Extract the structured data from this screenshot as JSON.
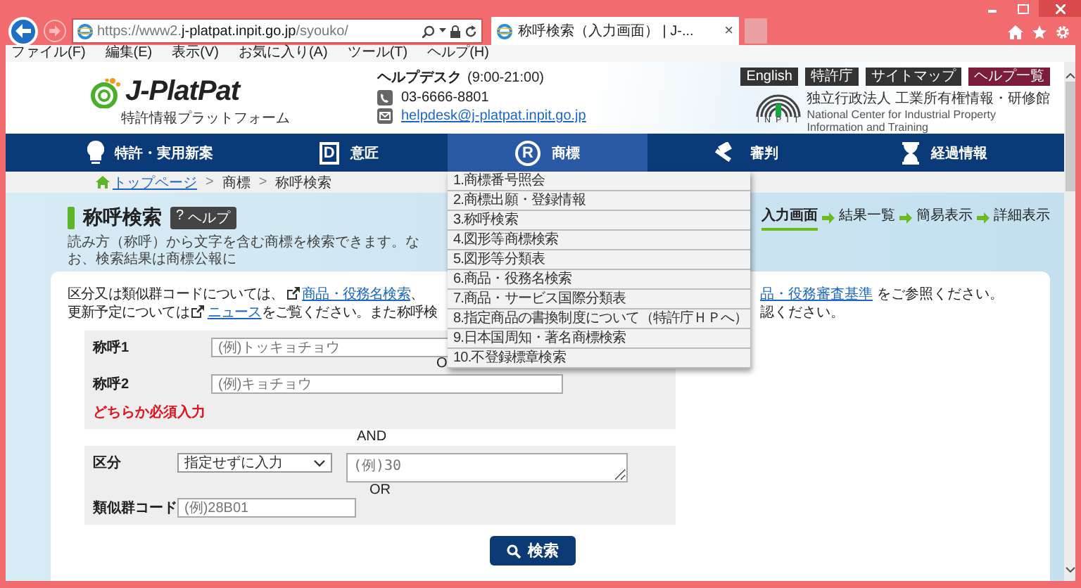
{
  "browser": {
    "url": {
      "prefix": "https://www2.",
      "domain": "j-platpat.inpit.go.jp",
      "path": "/syouko/"
    },
    "tab": {
      "title": "称呼検索（入力画面） | J-...",
      "close": "×"
    }
  },
  "menu_bar": [
    "ファイル(F)",
    "編集(E)",
    "表示(V)",
    "お気に入り(A)",
    "ツール(T)",
    "ヘルプ(H)"
  ],
  "header": {
    "logo": {
      "name": "J-PlatPat",
      "subtitle": "特許情報プラットフォーム"
    },
    "helpdesk": {
      "title": "ヘルプデスク",
      "hours": "(9:00-21:00)",
      "contacts": [
        {
          "kind": "phone",
          "text": "03-6666-8801"
        },
        {
          "kind": "email",
          "text": "helpdesk@j-platpat.inpit.go.jp"
        }
      ]
    },
    "top_links": [
      {
        "label": "English",
        "kind": "plain"
      },
      {
        "label": "特許庁",
        "kind": "plain"
      },
      {
        "label": "サイトマップ",
        "kind": "plain"
      },
      {
        "label": "ヘルプ一覧",
        "kind": "accent"
      }
    ],
    "organization": {
      "acronym": "I N P I T",
      "name_ja": "独立行政法人 工業所有権情報・研修館",
      "name_en": [
        "National Center for Industrial Property",
        "Information and Training"
      ]
    }
  },
  "nav": [
    {
      "label": "特許・実用新案",
      "kind": "bulb",
      "selected": false
    },
    {
      "label": "意匠",
      "kind": "letter_box",
      "icon_text": "D",
      "selected": false
    },
    {
      "label": "商標",
      "kind": "letter_circle",
      "icon_text": "R",
      "selected": true
    },
    {
      "label": "審判",
      "kind": "gavel",
      "selected": false
    },
    {
      "label": "経過情報",
      "kind": "hourglass",
      "selected": false
    }
  ],
  "breadcrumb": [
    {
      "kind": "home_link",
      "label": "トップページ"
    },
    {
      "kind": "separator",
      "label": ">"
    },
    {
      "kind": "text",
      "label": "商標"
    },
    {
      "kind": "separator",
      "label": ">"
    },
    {
      "kind": "text",
      "label": "称呼検索"
    }
  ],
  "page": {
    "title": "称呼検索",
    "help_button": {
      "icon_text": "?",
      "label": "ヘルプ"
    },
    "steps": [
      {
        "label": "入力画面",
        "selected": true
      },
      {
        "label": "結果一覧",
        "selected": false
      },
      {
        "label": "簡易表示",
        "selected": false
      },
      {
        "label": "詳細表示",
        "selected": false
      }
    ],
    "description": "読み方（称呼）から文字を含む商標を検索できます。なお、検索結果は商標公報に"
  },
  "notice": [
    {
      "left": [
        {
          "kind": "text",
          "text": "区分又は類似群コードについては、"
        },
        {
          "kind": "ext_link",
          "text": "商品・役務名検索"
        },
        {
          "kind": "text",
          "text": "、"
        }
      ],
      "right": [
        {
          "kind": "link",
          "text": "品・役務審査基準"
        },
        {
          "kind": "text",
          "text": " をご参照ください。"
        }
      ]
    },
    {
      "left": [
        {
          "kind": "text",
          "text": "更新予定については"
        },
        {
          "kind": "ext_link",
          "text": "ニュース"
        },
        {
          "kind": "text",
          "text": "をご覧ください。また称呼検"
        }
      ],
      "right": [
        {
          "kind": "text",
          "text": "認ください。"
        }
      ]
    }
  ],
  "form": {
    "name_fields": [
      {
        "label": "称呼1",
        "placeholder": "(例)トッキョチョウ"
      },
      {
        "label": "称呼2",
        "placeholder": "(例)キョチョウ"
      }
    ],
    "partial_or": "O",
    "required_note": "どちらか必須入力",
    "and_label": "AND",
    "class_field": {
      "label": "区分",
      "select_value": "指定せずに入力",
      "placeholder": "(例)30"
    },
    "or_label": "OR",
    "group_code_field": {
      "label": "類似群コード",
      "placeholder": "(例)28B01"
    },
    "search_button": "検索"
  },
  "dropdown": [
    "1.商標番号照会",
    "2.商標出願・登録情報",
    "3.称呼検索",
    "4.図形等商標検索",
    "5.図形等分類表",
    "6.商品・役務名検索",
    "7.商品・サービス国際分類表",
    "8.指定商品の書換制度について（特許庁ＨＰへ）",
    "9.日本国周知・著名商標検索",
    "10.不登録標章検索"
  ]
}
